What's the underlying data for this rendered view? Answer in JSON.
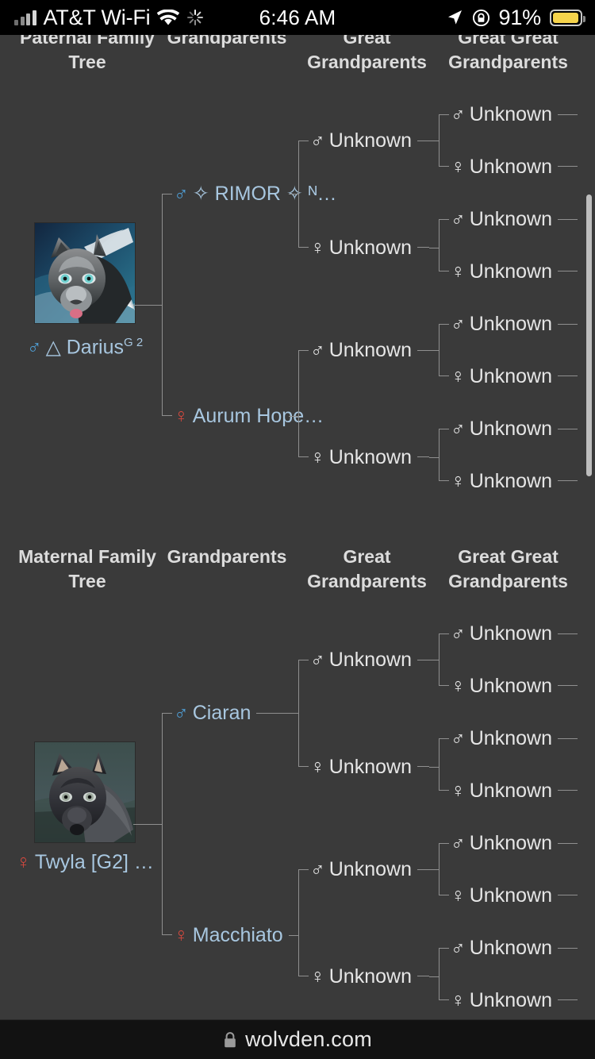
{
  "status_bar": {
    "carrier": "AT&T Wi-Fi",
    "time": "6:46 AM",
    "battery_percent": "91%",
    "icons": [
      "signal-bars-icon",
      "wifi-icon",
      "activity-spinner-icon",
      "location-arrow-icon",
      "rotation-lock-icon",
      "battery-icon"
    ]
  },
  "browser": {
    "url": "wolvden.com",
    "lock_icon": "lock-icon"
  },
  "paternal": {
    "headers": {
      "col0": "Paternal Family Tree",
      "col1": "Grandparents",
      "col2": "Great Grandparents",
      "col3": "Great Great Grandparents"
    },
    "subject": {
      "symbol": "♂",
      "sex": "male",
      "marker": "△",
      "name": "Darius",
      "suffix": "G 2",
      "portrait_alt": "darius-wolf-portrait"
    },
    "grandparents": [
      {
        "symbol": "♂",
        "sex": "male",
        "name": "✧ RIMOR ✧ ᴺ…"
      },
      {
        "symbol": "♀",
        "sex": "female",
        "name": "Aurum Hope…"
      }
    ],
    "great_grandparents": [
      {
        "symbol": "♂",
        "sex": "unknown",
        "name": "Unknown"
      },
      {
        "symbol": "♀",
        "sex": "unknown",
        "name": "Unknown"
      },
      {
        "symbol": "♂",
        "sex": "unknown",
        "name": "Unknown"
      },
      {
        "symbol": "♀",
        "sex": "unknown",
        "name": "Unknown"
      }
    ],
    "great_great_grandparents": [
      {
        "symbol": "♂",
        "sex": "unknown",
        "name": "Unknown"
      },
      {
        "symbol": "♀",
        "sex": "unknown",
        "name": "Unknown"
      },
      {
        "symbol": "♂",
        "sex": "unknown",
        "name": "Unknown"
      },
      {
        "symbol": "♀",
        "sex": "unknown",
        "name": "Unknown"
      },
      {
        "symbol": "♂",
        "sex": "unknown",
        "name": "Unknown"
      },
      {
        "symbol": "♀",
        "sex": "unknown",
        "name": "Unknown"
      },
      {
        "symbol": "♂",
        "sex": "unknown",
        "name": "Unknown"
      },
      {
        "symbol": "♀",
        "sex": "unknown",
        "name": "Unknown"
      }
    ]
  },
  "maternal": {
    "headers": {
      "col0": "Maternal Family Tree",
      "col1": "Grandparents",
      "col2": "Great Grandparents",
      "col3": "Great Great Grandparents"
    },
    "subject": {
      "symbol": "♀",
      "sex": "female",
      "name": "Twyla [G2] …",
      "portrait_alt": "twyla-wolf-portrait"
    },
    "grandparents": [
      {
        "symbol": "♂",
        "sex": "male",
        "name": "Ciaran"
      },
      {
        "symbol": "♀",
        "sex": "female",
        "name": "Macchiato"
      }
    ],
    "great_grandparents": [
      {
        "symbol": "♂",
        "sex": "unknown",
        "name": "Unknown"
      },
      {
        "symbol": "♀",
        "sex": "unknown",
        "name": "Unknown"
      },
      {
        "symbol": "♂",
        "sex": "unknown",
        "name": "Unknown"
      },
      {
        "symbol": "♀",
        "sex": "unknown",
        "name": "Unknown"
      }
    ],
    "great_great_grandparents": [
      {
        "symbol": "♂",
        "sex": "unknown",
        "name": "Unknown"
      },
      {
        "symbol": "♀",
        "sex": "unknown",
        "name": "Unknown"
      },
      {
        "symbol": "♂",
        "sex": "unknown",
        "name": "Unknown"
      },
      {
        "symbol": "♀",
        "sex": "unknown",
        "name": "Unknown"
      },
      {
        "symbol": "♂",
        "sex": "unknown",
        "name": "Unknown"
      },
      {
        "symbol": "♀",
        "sex": "unknown",
        "name": "Unknown"
      },
      {
        "symbol": "♂",
        "sex": "unknown",
        "name": "Unknown"
      },
      {
        "symbol": "♀",
        "sex": "unknown",
        "name": "Unknown"
      }
    ]
  },
  "colors": {
    "background": "#3a3a3a",
    "male": "#4f9fd6",
    "female": "#d4493f",
    "link": "#a8c7e0",
    "text": "#e6e6e6",
    "line": "#8f8f8f",
    "battery": "#f5d34b"
  }
}
